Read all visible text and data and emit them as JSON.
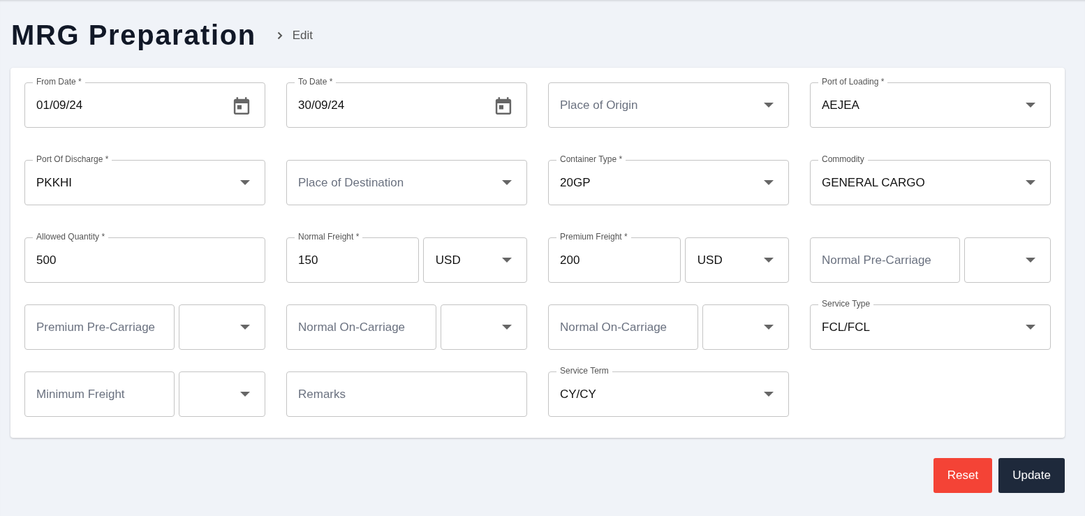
{
  "header": {
    "title": "MRG Preparation",
    "breadcrumb": "Edit"
  },
  "fields": [
    {
      "kind": "date",
      "label": "From Date *",
      "value": "01/09/24"
    },
    {
      "kind": "date",
      "label": "To Date *",
      "value": "30/09/24"
    },
    {
      "kind": "select",
      "placeholder": "Place of Origin"
    },
    {
      "kind": "select",
      "label": "Port of Loading *",
      "value": "AEJEA"
    },
    {
      "kind": "select",
      "label": "Port Of Discharge *",
      "value": "PKKHI"
    },
    {
      "kind": "select",
      "placeholder": "Place of Destination"
    },
    {
      "kind": "select",
      "label": "Container Type *",
      "value": "20GP"
    },
    {
      "kind": "select",
      "label": "Commodity",
      "value": "GENERAL CARGO"
    },
    {
      "kind": "text",
      "label": "Allowed Quantity *",
      "value": "500"
    },
    {
      "kind": "amount",
      "label": "Normal Freight *",
      "value": "150",
      "currency": "USD"
    },
    {
      "kind": "amount",
      "label": "Premium Freight *",
      "value": "200",
      "currency": "USD"
    },
    {
      "kind": "amount",
      "placeholder": "Normal Pre-Carriage"
    },
    {
      "kind": "amount",
      "placeholder": "Premium Pre-Carriage"
    },
    {
      "kind": "amount",
      "placeholder": "Normal On-Carriage"
    },
    {
      "kind": "amount",
      "placeholder": "Normal On-Carriage"
    },
    {
      "kind": "select",
      "label": "Service Type",
      "value": "FCL/FCL"
    },
    {
      "kind": "amount",
      "placeholder": "Minimum Freight"
    },
    {
      "kind": "text",
      "placeholder": "Remarks"
    },
    {
      "kind": "select",
      "label": "Service Term",
      "value": "CY/CY"
    }
  ],
  "buttons": [
    {
      "kind": "reset",
      "label": "Reset"
    },
    {
      "kind": "update",
      "label": "Update"
    }
  ]
}
